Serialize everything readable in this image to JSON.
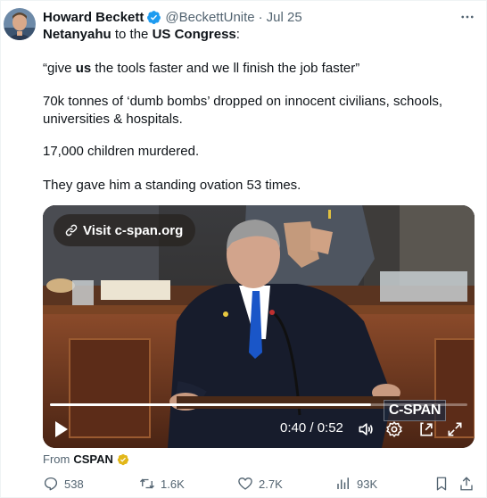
{
  "author": {
    "name": "Howard Beckett",
    "handle": "@BeckettUnite",
    "separator": "·",
    "date": "Jul 25"
  },
  "post": {
    "line1_a": "Netanyahu",
    "line1_b": " to the ",
    "line1_c": "US Congress",
    "line1_d": ":",
    "quote_a": "“give ",
    "quote_b": "us",
    "quote_c": " the tools faster and we ll finish the job faster”",
    "bombs": "70k tonnes of ‘dumb bombs’ dropped on innocent civilians, schools, universities & hospitals.",
    "children": "17,000 children murdered.",
    "ovation": "They gave him a standing ovation 53 times."
  },
  "video": {
    "visit_label": "Visit c-span.org",
    "watermark": "C-SPAN",
    "time": "0:40 / 0:52",
    "progress_fraction": 0.77
  },
  "source": {
    "prefix": "From",
    "name": "CSPAN"
  },
  "stats": {
    "replies": "538",
    "reposts": "1.6K",
    "likes": "2.7K",
    "views": "93K"
  },
  "colors": {
    "verified_blue": "#1d9bf0",
    "verified_gold": "#e2b719",
    "muted_text": "#536471",
    "text": "#0f1419"
  },
  "icons": [
    "verified-badge-icon",
    "more-icon",
    "link-icon",
    "play-icon",
    "volume-icon",
    "settings-icon",
    "exit-icon",
    "fullscreen-icon",
    "reply-icon",
    "repost-icon",
    "like-icon",
    "views-icon",
    "bookmark-icon",
    "share-icon"
  ]
}
